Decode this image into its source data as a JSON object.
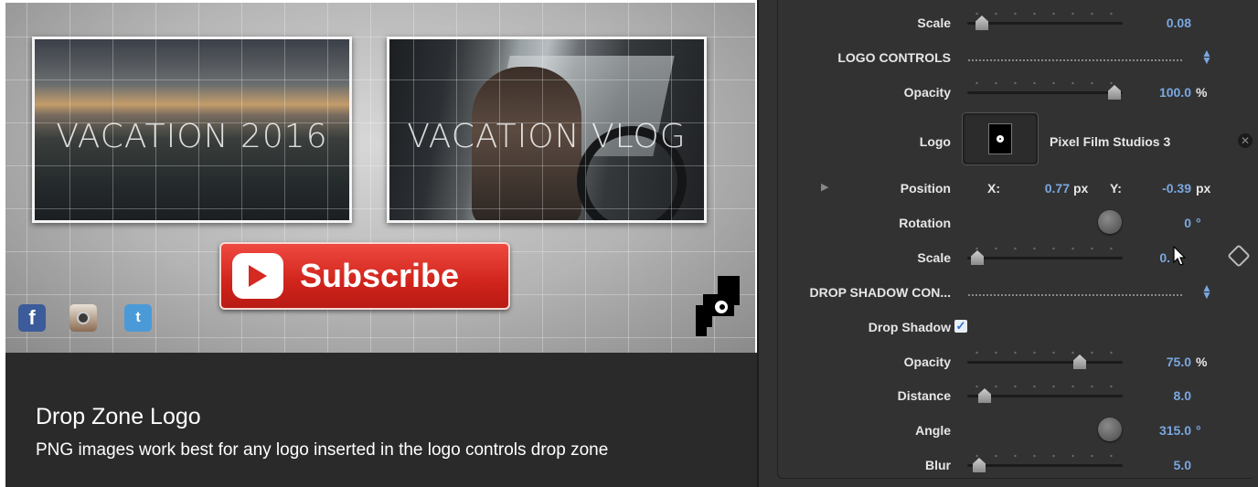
{
  "preview": {
    "thumb1_label": "VACATION 2016",
    "thumb2_label": "VACATION VLOG",
    "subscribe_label": "Subscribe",
    "social_icons": [
      "facebook-icon",
      "instagram-icon",
      "twitter-icon"
    ],
    "facebook_glyph": "f",
    "twitter_glyph": "t"
  },
  "caption": {
    "title": "Drop Zone Logo",
    "description": "PNG images work best for any logo inserted in the logo controls drop zone"
  },
  "inspector": {
    "scale_top": {
      "label": "Scale",
      "value": "0.08",
      "level": 0.06
    },
    "logo_controls": {
      "label": "LOGO CONTROLS"
    },
    "opacity": {
      "label": "Opacity",
      "value": "100.0",
      "unit": "%",
      "level": 1.0
    },
    "logo": {
      "label": "Logo",
      "name": "Pixel Film Studios 3"
    },
    "position": {
      "label": "Position",
      "x_label": "X:",
      "x_value": "0.77",
      "x_unit": "px",
      "y_label": "Y:",
      "y_value": "-0.39",
      "y_unit": "px"
    },
    "rotation": {
      "label": "Rotation",
      "value": "0",
      "unit": "°"
    },
    "scale": {
      "label": "Scale",
      "value": "0.",
      "level": 0.03
    },
    "drop_shadow_controls": {
      "label": "DROP SHADOW CON..."
    },
    "drop_shadow": {
      "label": "Drop Shadow",
      "checked": true
    },
    "shadow_opacity": {
      "label": "Opacity",
      "value": "75.0",
      "unit": "%",
      "level": 0.75
    },
    "distance": {
      "label": "Distance",
      "value": "8.0",
      "level": 0.08
    },
    "angle": {
      "label": "Angle",
      "value": "315.0",
      "unit": "°"
    },
    "blur": {
      "label": "Blur",
      "value": "5.0",
      "level": 0.03
    }
  },
  "colors": {
    "accent_value": "#7aa7e0",
    "subscribe_red": "#d0241c",
    "panel_bg": "#323233",
    "caption_bg": "#2a2a2a"
  }
}
